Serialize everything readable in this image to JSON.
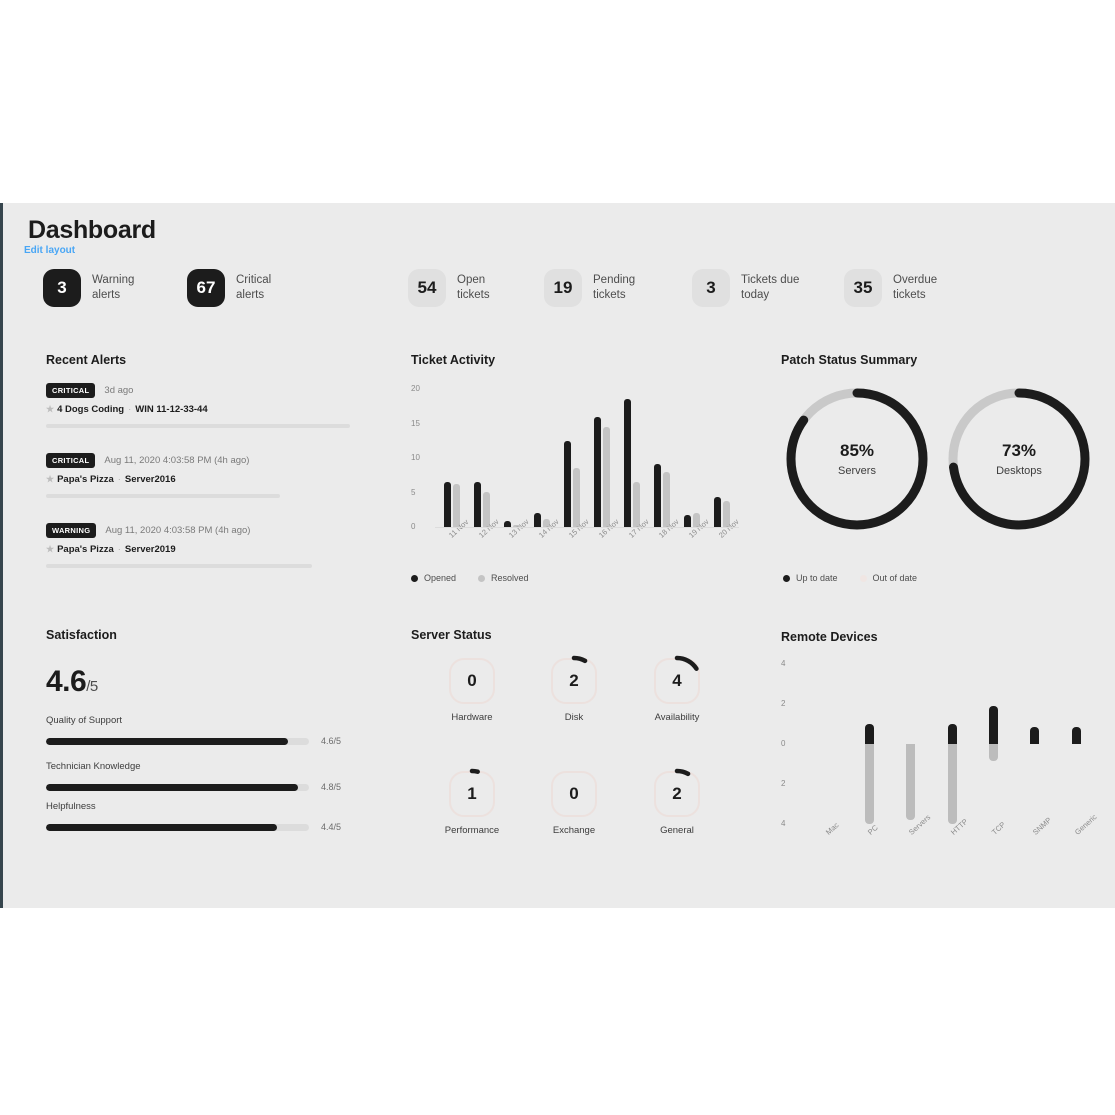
{
  "header": {
    "title": "Dashboard",
    "edit_layout": "Edit layout"
  },
  "kpis": [
    {
      "value": "3",
      "label": "Warning\nalerts",
      "style": "dark"
    },
    {
      "value": "67",
      "label": "Critical\nalerts",
      "style": "dark"
    },
    {
      "value": "54",
      "label": "Open\ntickets",
      "style": "light"
    },
    {
      "value": "19",
      "label": "Pending\ntickets",
      "style": "light"
    },
    {
      "value": "3",
      "label": "Tickets due\ntoday",
      "style": "light"
    },
    {
      "value": "35",
      "label": "Overdue\ntickets",
      "style": "light"
    }
  ],
  "recent_alerts": {
    "title": "Recent Alerts",
    "items": [
      {
        "severity": "CRITICAL",
        "time": "3d ago",
        "client": "4 Dogs Coding",
        "separator": "·",
        "device": "WIN 11-12-33-44",
        "bar_width": "95%"
      },
      {
        "severity": "CRITICAL",
        "time": "Aug 11, 2020 4:03:58 PM (4h ago)",
        "client": "Papa's Pizza",
        "separator": "·",
        "device": "Server2016",
        "bar_width": "73%"
      },
      {
        "severity": "WARNING",
        "time": "Aug 11, 2020 4:03:58 PM (4h ago)",
        "client": "Papa's Pizza",
        "separator": "·",
        "device": "Server2019",
        "bar_width": "83%"
      }
    ]
  },
  "satisfaction": {
    "title": "Satisfaction",
    "score": "4.6",
    "denominator": "/5",
    "metrics": [
      {
        "name": "Quality of Support",
        "value": "4.6/5",
        "pct": 92
      },
      {
        "name": "Technician Knowledge",
        "value": "4.8/5",
        "pct": 96
      },
      {
        "name": "Helpfulness",
        "value": "4.4/5",
        "pct": 88
      }
    ]
  },
  "server_status": {
    "title": "Server Status",
    "gauges": [
      {
        "value": "0",
        "name": "Hardware",
        "pct": 0
      },
      {
        "value": "2",
        "name": "Disk",
        "pct": 8
      },
      {
        "value": "4",
        "name": "Availability",
        "pct": 16
      },
      {
        "value": "1",
        "name": "Performance",
        "pct": 4
      },
      {
        "value": "0",
        "name": "Exchange",
        "pct": 0
      },
      {
        "value": "2",
        "name": "General",
        "pct": 8
      }
    ]
  },
  "patch_status": {
    "title": "Patch Status Summary",
    "legend": [
      {
        "label": "Up to date",
        "color": "#1c1c1c"
      },
      {
        "label": "Out of date",
        "color": "#f0e6e3"
      }
    ],
    "donuts": [
      {
        "pct": 85,
        "pct_label": "85%",
        "name": "Servers"
      },
      {
        "pct": 73,
        "pct_label": "73%",
        "name": "Desktops"
      }
    ]
  },
  "chart_data": [
    {
      "type": "bar",
      "name": "ticket-activity",
      "title": "Ticket Activity",
      "xlabel": "",
      "ylabel": "",
      "ylim": [
        0,
        20
      ],
      "yticks": [
        0,
        5,
        10,
        15,
        20
      ],
      "grid": false,
      "legend_position": "bottom-left",
      "categories": [
        "11 Nov",
        "12 Nov",
        "13 Nov",
        "14 Nov",
        "15 Nov",
        "16 Nov",
        "17 Nov",
        "18 Nov",
        "19 Nov",
        "20 Nov"
      ],
      "series": [
        {
          "name": "Opened",
          "color": "#1c1c1c",
          "values": [
            6.5,
            6.5,
            0.8,
            2.0,
            12.5,
            16.0,
            18.5,
            9.2,
            1.7,
            4.3
          ]
        },
        {
          "name": "Resolved",
          "color": "#c4c4c4",
          "values": [
            6.3,
            5.1,
            0.3,
            1.2,
            8.5,
            14.5,
            6.5,
            8.0,
            2.0,
            3.7
          ]
        }
      ]
    },
    {
      "type": "bar",
      "name": "remote-devices",
      "title": "Remote Devices",
      "xlabel": "",
      "ylabel": "",
      "ylim": [
        -4,
        4
      ],
      "yticks": [
        "4",
        "2",
        "0",
        "2",
        "4"
      ],
      "grid": false,
      "diverging": true,
      "categories": [
        "Mac",
        "PC",
        "Servers",
        "HTTP",
        "TCP",
        "SNMP",
        "Generic"
      ],
      "series": [
        {
          "name": "positive",
          "color": "#1c1c1c",
          "values": [
            0,
            1.0,
            0,
            1.0,
            1.9,
            0.85,
            0.85
          ]
        },
        {
          "name": "negative",
          "color": "#bcbcbc",
          "values": [
            0,
            -4.0,
            -3.8,
            -4.0,
            -0.85,
            0,
            0
          ]
        }
      ]
    }
  ]
}
